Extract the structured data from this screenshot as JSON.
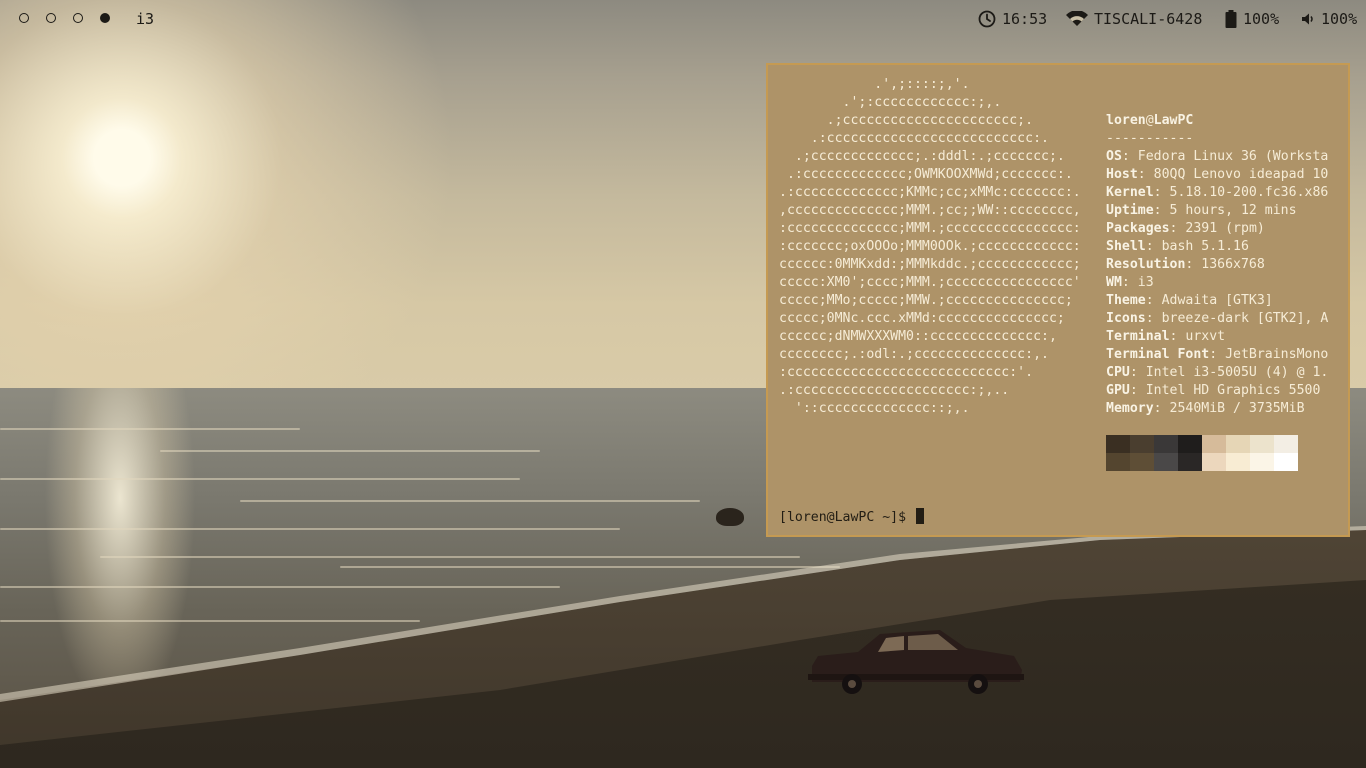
{
  "topbar": {
    "workspaces": [
      {
        "id": "ws1",
        "active": false
      },
      {
        "id": "ws2",
        "active": false
      },
      {
        "id": "ws3",
        "active": false
      },
      {
        "id": "ws4",
        "active": true
      }
    ],
    "wm_label": "i3",
    "clock": {
      "icon": "clock-icon",
      "time": "16:53"
    },
    "wifi": {
      "icon": "wifi-icon",
      "ssid": "TISCALI-6428"
    },
    "battery": {
      "icon": "battery-icon",
      "level": "100%"
    },
    "volume": {
      "icon": "volume-icon",
      "level": "100%"
    },
    "text_color": "#1c1a16"
  },
  "terminal": {
    "background": "#ae9368",
    "border_color": "#c59a52",
    "logo_ascii": "            .',;::::;,'.\n        .';:cccccccccccc:;,.\n      .;cccccccccccccccccccccc;.\n    .:cccccccccccccccccccccccccc:.\n  .;ccccccccccccc;.:dddl:.;ccccccc;.\n .:ccccccccccccc;OWMKOOXMWd;ccccccc:.\n.:ccccccccccccc;KMMc;cc;xMMc:ccccccc:.\n,cccccccccccccc;MMM.;cc;;WW::cccccccc,\n:cccccccccccccc;MMM.;cccccccccccccccc:\n:ccccccc;oxOOOo;MMM0OOk.;cccccccccccc:\ncccccc:0MMKxdd:;MMMkddc.;cccccccccccc;\nccccc:XM0';cccc;MMM.;cccccccccccccccc'\nccccc;MMo;ccccc;MMW.;ccccccccccccccc;\nccccc;0MNc.ccc.xMMd:ccccccccccccccc;\ncccccc;dNMWXXXWM0::cccccccccccccc:,\ncccccccc;.:odl:.;cccccccccccccc:,.\n:cccccccccccccccccccccccccccc:'.\n.:cccccccccccccccccccccc:;,..\n  '::cccccccccccccc::;,.",
    "user": "loren",
    "at": "@",
    "host": "LawPC",
    "divider": "-----------",
    "info": [
      {
        "key": "OS",
        "value": "Fedora Linux 36 (Worksta"
      },
      {
        "key": "Host",
        "value": "80QQ Lenovo ideapad 10"
      },
      {
        "key": "Kernel",
        "value": "5.18.10-200.fc36.x86"
      },
      {
        "key": "Uptime",
        "value": "5 hours, 12 mins"
      },
      {
        "key": "Packages",
        "value": "2391 (rpm)"
      },
      {
        "key": "Shell",
        "value": "bash 5.1.16"
      },
      {
        "key": "Resolution",
        "value": "1366x768"
      },
      {
        "key": "WM",
        "value": "i3"
      },
      {
        "key": "Theme",
        "value": "Adwaita [GTK3]"
      },
      {
        "key": "Icons",
        "value": "breeze-dark [GTK2], A"
      },
      {
        "key": "Terminal",
        "value": "urxvt"
      },
      {
        "key": "Terminal Font",
        "value": "JetBrainsMono"
      },
      {
        "key": "CPU",
        "value": "Intel i3-5005U (4) @ 1."
      },
      {
        "key": "GPU",
        "value": "Intel HD Graphics 5500"
      },
      {
        "key": "Memory",
        "value": "2540MiB / 3735MiB"
      }
    ],
    "palette_top": [
      "#3a2f22",
      "#4a3e2f",
      "#3a3838",
      "#1f1d1c",
      "#d6bb9a",
      "#e6d6b6",
      "#ece3cc",
      "#f3eee4"
    ],
    "palette_bottom": [
      "#54452f",
      "#5e4e36",
      "#4a4848",
      "#2a2726",
      "#ecd7bd",
      "#f8ecd3",
      "#fbf5e7",
      "#ffffff"
    ],
    "prompt": "[loren@LawPC ~]$"
  }
}
